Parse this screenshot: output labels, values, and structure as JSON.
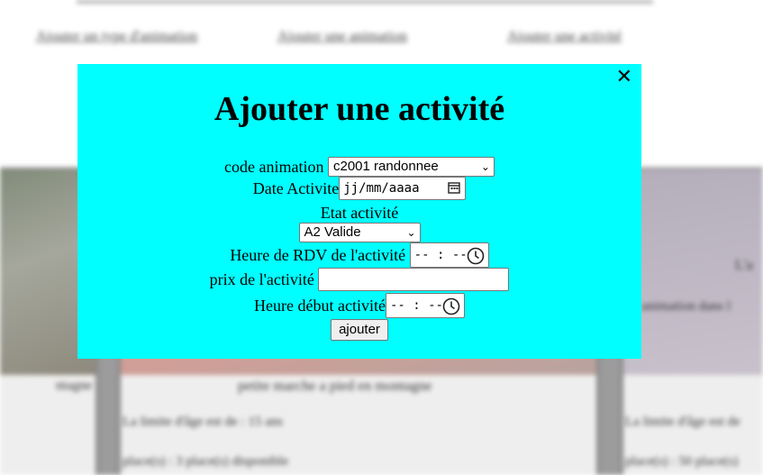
{
  "background": {
    "nav_links": [
      "Ajouter un type d'animation",
      "Ajouter une animation",
      "Ajouter une activité"
    ],
    "card_title": "petite marche a pied en montagne",
    "card_age": "La limite d'âge est de : 15 ans",
    "card_places": "place(s) : 3 place(s) disponible",
    "left_fragment": "ntagne",
    "right_age": "La limite d'âge est de",
    "right_places": "place(s) : 50 place(s)",
    "right_fragment_1": "L'a",
    "right_fragment_2": "animation dans l"
  },
  "modal": {
    "title": "Ajouter une activité",
    "close_glyph": "✕",
    "code_animation_label": "code animation",
    "code_animation_value": "c2001 randonnee",
    "date_label": "Date Activite",
    "date_placeholder": "jj/mm/aaaa",
    "etat_label": "Etat activité",
    "etat_value": "A2 Valide",
    "heure_rdv_label": "Heure de RDV de l'activité",
    "heure_rdv_placeholder": "-- : --",
    "prix_label": "prix de l'activité",
    "prix_value": "",
    "heure_debut_label": "Heure début activité",
    "heure_debut_placeholder": "-- : --",
    "submit_label": "ajouter"
  },
  "colors": {
    "modal_background": "#00ffff",
    "control_border": "#767676",
    "button_background": "#efefef"
  },
  "icons": [
    "close-icon",
    "calendar-icon",
    "clock-icon",
    "chevron-down-icon"
  ]
}
